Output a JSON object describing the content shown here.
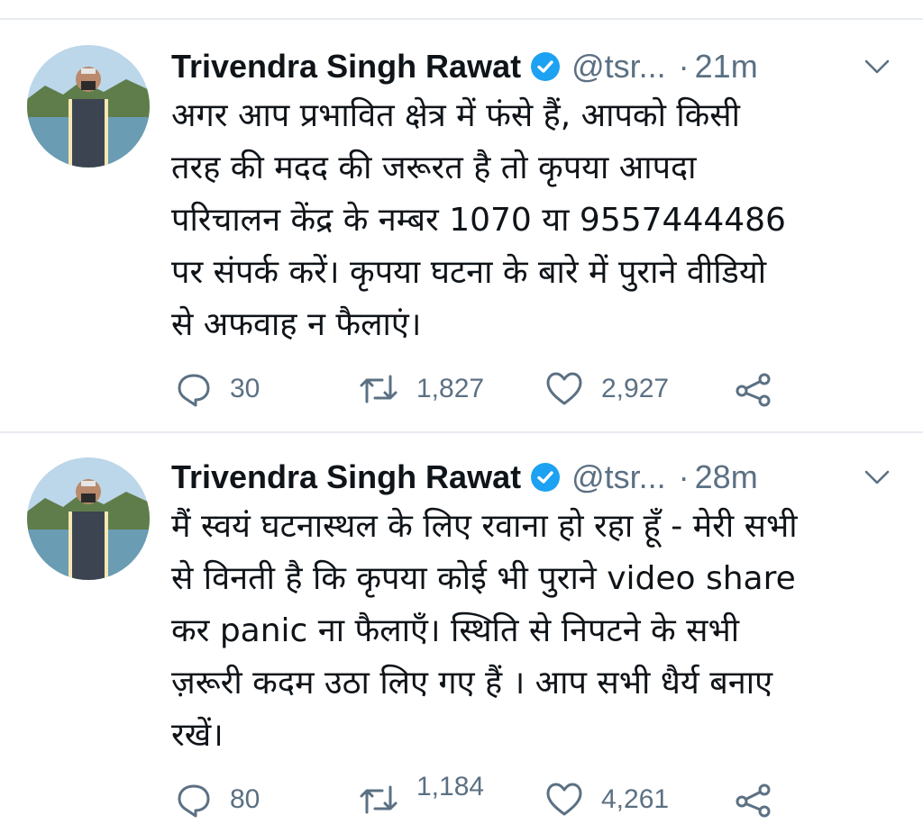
{
  "colors": {
    "text": "#0f1419",
    "secondary": "#5b7083",
    "verified": "#1da1f2",
    "divider": "#e6ecf0"
  },
  "tweets": [
    {
      "name": "Trivendra Singh Rawat",
      "handle": "@tsr...",
      "separator": "·",
      "time": "21m",
      "text": "अगर आप प्रभावित क्षेत्र में फंसे हैं, आपको किसी\nतरह की मदद की जरूरत है तो कृपया आपदा\nपरिचालन केंद्र के नम्बर 1070 या 9557444486\nपर संपर्क करें। कृपया घटना के बारे में पुराने वीडियो\nसे अफवाह न फैलाएं।",
      "replies": "30",
      "retweets": "1,827",
      "likes": "2,927",
      "icons": [
        "reply-icon",
        "retweet-icon",
        "like-icon",
        "share-icon"
      ]
    },
    {
      "name": "Trivendra Singh Rawat",
      "handle": "@tsr...",
      "separator": "·",
      "time": "28m",
      "text": "मैं स्वयं घटनास्थल के लिए रवाना हो रहा हूँ - मेरी सभी\nसे विनती है कि कृपया कोई भी पुराने video share\nकर panic ना फैलाएँ। स्थिति से निपटने के सभी\nज़रूरी कदम उठा लिए गए हैं । आप सभी धैर्य बनाए\nरखें।",
      "replies": "80",
      "retweets": "1,184",
      "likes": "4,261",
      "icons": [
        "reply-icon",
        "retweet-icon",
        "like-icon",
        "share-icon"
      ]
    }
  ]
}
